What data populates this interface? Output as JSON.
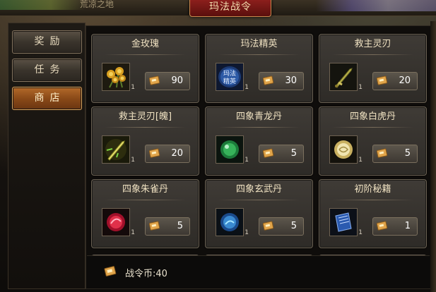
{
  "window": {
    "title": "玛法战令",
    "place_name": "荒凉之地"
  },
  "menu": [
    {
      "label": "奖励",
      "active": false
    },
    {
      "label": "任务",
      "active": false
    },
    {
      "label": "商店",
      "active": true
    }
  ],
  "shop": {
    "items": [
      {
        "name": "金玫瑰",
        "qty": "1",
        "cost": "90",
        "icon": "golden-rose-icon"
      },
      {
        "name": "玛法精英",
        "qty": "1",
        "cost": "30",
        "icon": "mafa-elite-badge-icon",
        "icon_text": "玛法精英"
      },
      {
        "name": "救主灵刃",
        "qty": "1",
        "cost": "20",
        "icon": "spirit-blade-icon"
      },
      {
        "name": "救主灵刃[魄]",
        "qty": "1",
        "cost": "20",
        "icon": "spirit-blade-soul-icon"
      },
      {
        "name": "四象青龙丹",
        "qty": "1",
        "cost": "5",
        "icon": "azure-dragon-pill-icon"
      },
      {
        "name": "四象白虎丹",
        "qty": "1",
        "cost": "5",
        "icon": "white-tiger-pill-icon"
      },
      {
        "name": "四象朱雀丹",
        "qty": "1",
        "cost": "5",
        "icon": "vermilion-bird-pill-icon"
      },
      {
        "name": "四象玄武丹",
        "qty": "1",
        "cost": "5",
        "icon": "black-tortoise-pill-icon"
      },
      {
        "name": "初阶秘籍",
        "qty": "1",
        "cost": "1",
        "icon": "beginner-manual-icon"
      }
    ]
  },
  "footer": {
    "currency_text": "战令币:40"
  },
  "colors": {
    "accent": "#8c1f1c",
    "active_tab": "#b36a2a",
    "card_border": "#6c6355"
  }
}
